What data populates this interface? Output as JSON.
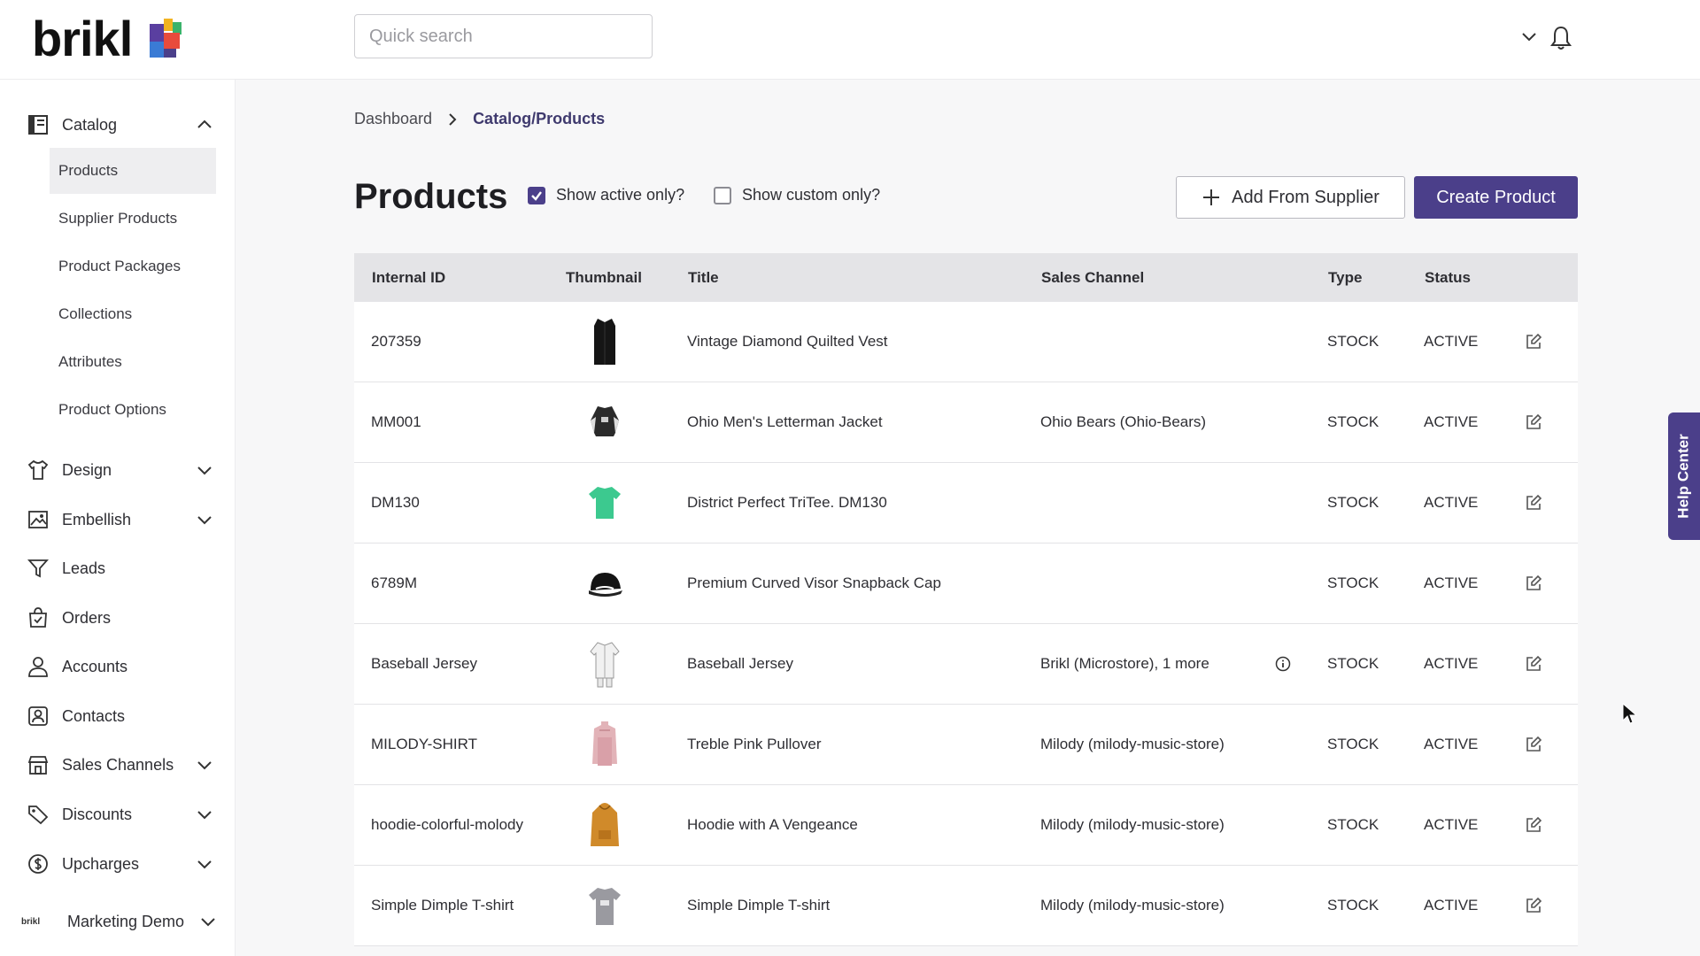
{
  "brand": {
    "name": "brikl"
  },
  "search": {
    "placeholder": "Quick search"
  },
  "sidebar": {
    "catalog": {
      "label": "Catalog"
    },
    "catalog_items": [
      {
        "label": "Products",
        "active": true
      },
      {
        "label": "Supplier Products"
      },
      {
        "label": "Product Packages"
      },
      {
        "label": "Collections"
      },
      {
        "label": "Attributes"
      },
      {
        "label": "Product Options"
      }
    ],
    "items": [
      {
        "label": "Design",
        "icon": "tshirt-icon",
        "expandable": true
      },
      {
        "label": "Embellish",
        "icon": "image-icon",
        "expandable": true
      },
      {
        "label": "Leads",
        "icon": "filter-icon",
        "expandable": false
      },
      {
        "label": "Orders",
        "icon": "shopping-bag-icon",
        "expandable": false
      },
      {
        "label": "Accounts",
        "icon": "user-icon",
        "expandable": false
      },
      {
        "label": "Contacts",
        "icon": "contact-icon",
        "expandable": false
      },
      {
        "label": "Sales Channels",
        "icon": "store-icon",
        "expandable": true
      },
      {
        "label": "Discounts",
        "icon": "tag-icon",
        "expandable": true
      },
      {
        "label": "Upcharges",
        "icon": "dollar-icon",
        "expandable": true
      }
    ],
    "org": {
      "label": "Marketing Demo",
      "logo_text": "brikl"
    }
  },
  "breadcrumb": {
    "home": "Dashboard",
    "current": "Catalog/Products"
  },
  "page": {
    "title": "Products",
    "show_active": {
      "label": "Show active only?",
      "checked": true
    },
    "show_custom": {
      "label": "Show custom only?",
      "checked": false
    },
    "add_supplier_label": "Add From Supplier",
    "create_label": "Create Product"
  },
  "table": {
    "headers": {
      "id": "Internal ID",
      "thumb": "Thumbnail",
      "title": "Title",
      "channel": "Sales Channel",
      "type": "Type",
      "status": "Status"
    },
    "rows": [
      {
        "id": "207359",
        "title": "Vintage Diamond Quilted Vest",
        "channel": "",
        "type": "STOCK",
        "status": "ACTIVE",
        "thumb": "vest"
      },
      {
        "id": "MM001",
        "title": "Ohio Men's Letterman Jacket",
        "channel": "Ohio Bears (Ohio-Bears)",
        "type": "STOCK",
        "status": "ACTIVE",
        "thumb": "jacket"
      },
      {
        "id": "DM130",
        "title": "District Perfect TriTee. DM130",
        "channel": "",
        "type": "STOCK",
        "status": "ACTIVE",
        "thumb": "tee"
      },
      {
        "id": "6789M",
        "title": "Premium Curved Visor Snapback Cap",
        "channel": "",
        "type": "STOCK",
        "status": "ACTIVE",
        "thumb": "cap"
      },
      {
        "id": "Baseball Jersey",
        "title": "Baseball Jersey",
        "channel": "Brikl (Microstore), 1 more",
        "type": "STOCK",
        "status": "ACTIVE",
        "thumb": "jersey",
        "info": true
      },
      {
        "id": "MILODY-SHIRT",
        "title": "Treble Pink Pullover",
        "channel": "Milody (milody-music-store)",
        "type": "STOCK",
        "status": "ACTIVE",
        "thumb": "pullover"
      },
      {
        "id": "hoodie-colorful-molody",
        "title": "Hoodie with A Vengeance",
        "channel": "Milody (milody-music-store)",
        "type": "STOCK",
        "status": "ACTIVE",
        "thumb": "hoodie"
      },
      {
        "id": "Simple Dimple T-shirt",
        "title": "Simple Dimple T-shirt",
        "channel": "Milody (milody-music-store)",
        "type": "STOCK",
        "status": "ACTIVE",
        "thumb": "greytee"
      }
    ]
  },
  "help": {
    "label": "Help Center"
  },
  "colors": {
    "accent": "#4b3f8a",
    "header_bg": "#e4e4e7"
  }
}
